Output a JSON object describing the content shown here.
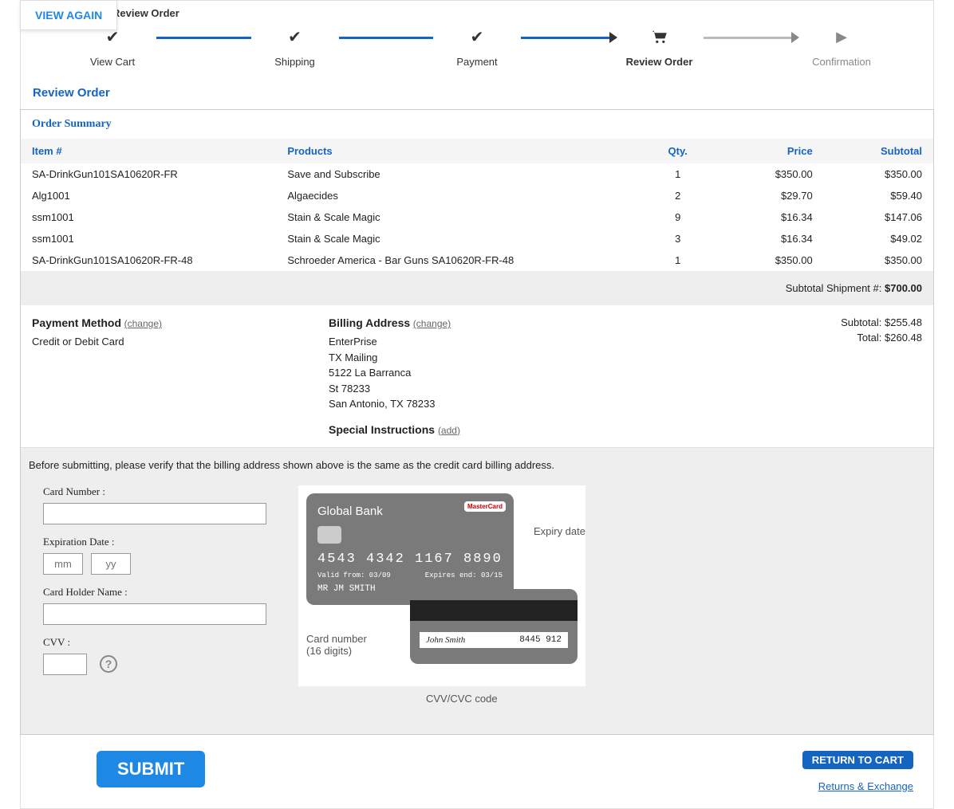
{
  "view_again": "VIEW AGAIN",
  "top_label": "Review Order",
  "progress": {
    "steps": [
      "View Cart",
      "Shipping",
      "Payment",
      "Review Order",
      "Confirmation"
    ]
  },
  "section_title": "Review Order",
  "order_summary": {
    "title": "Order Summary",
    "headers": {
      "item": "Item #",
      "products": "Products",
      "qty": "Qty.",
      "price": "Price",
      "subtotal": "Subtotal"
    },
    "rows": [
      {
        "item": "SA-DrinkGun101SA10620R-FR",
        "product": "Save and Subscribe",
        "qty": "1",
        "price": "$350.00",
        "subtotal": "$350.00"
      },
      {
        "item": "Alg1001",
        "product": "Algaecides",
        "qty": "2",
        "price": "$29.70",
        "subtotal": "$59.40"
      },
      {
        "item": "ssm1001",
        "product": "Stain & Scale Magic",
        "qty": "9",
        "price": "$16.34",
        "subtotal": "$147.06"
      },
      {
        "item": "ssm1001",
        "product": "Stain & Scale Magic",
        "qty": "3",
        "price": "$16.34",
        "subtotal": "$49.02"
      },
      {
        "item": "SA-DrinkGun101SA10620R-FR-48",
        "product": "Schroeder America - Bar Guns SA10620R-FR-48",
        "qty": "1",
        "price": "$350.00",
        "subtotal": "$350.00"
      }
    ],
    "shipment_label": "Subtotal Shipment #: ",
    "shipment_value": "$700.00"
  },
  "payment_method": {
    "title": "Payment Method",
    "change": "(change)",
    "value": "Credit or Debit Card"
  },
  "billing_address": {
    "title": "Billing Address",
    "change": "(change)",
    "lines": [
      "EnterPrise",
      "TX Mailing",
      "5122 La Barranca",
      "St 78233",
      "San Antonio, TX 78233"
    ]
  },
  "special_instructions": {
    "title": "Special Instructions",
    "add": "(add)"
  },
  "totals": {
    "subtotal_label": "Subtotal: ",
    "subtotal": "$255.48",
    "total_label": "Total: ",
    "total": "$260.48"
  },
  "verify_text": "Before submitting, please verify that the billing address shown above is the same as the credit card billing address.",
  "form": {
    "card_number": "Card Number :",
    "expiration": "Expiration Date :",
    "mm_placeholder": "mm",
    "yy_placeholder": "yy",
    "holder": "Card Holder Name :",
    "cvv": "CVV :"
  },
  "card_image": {
    "bank": "Global Bank",
    "logo": "MasterCard",
    "number": "4543 4342 1167 8890",
    "valid_from": "Valid from: 03/09",
    "expires": "Expires end: 03/15",
    "name": "MR JM SMITH",
    "sig_name": "John Smith",
    "sig_code": "8445 912",
    "annot_expiry": "Expiry date",
    "annot_cardnum_l1": "Card number",
    "annot_cardnum_l2": "(16 digits)",
    "annot_cvv": "CVV/CVC code"
  },
  "footer": {
    "submit": "SUBMIT",
    "return": "RETURN TO CART",
    "returns_link": "Returns & Exchange"
  }
}
